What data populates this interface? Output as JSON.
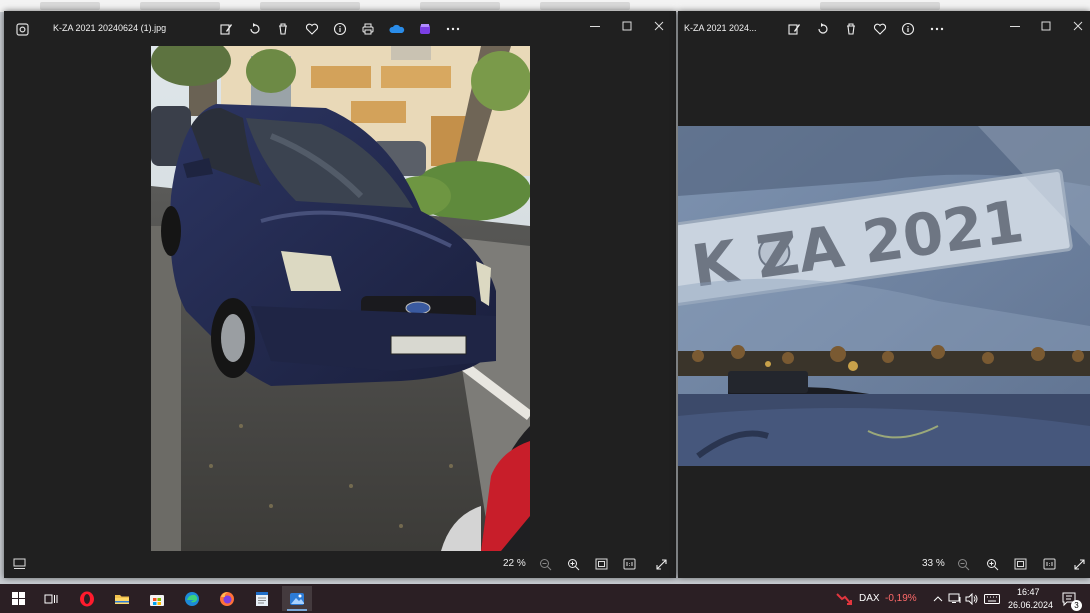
{
  "windows": [
    {
      "title": "K-ZA 2021 20240624   (1).jpg",
      "zoom": "22 %",
      "toolbar_icons": [
        "edit-icon",
        "rotate-icon",
        "delete-icon",
        "heart-icon",
        "info-icon",
        "print-icon",
        "onedrive-icon",
        "clipchamp-icon",
        "more-icon"
      ],
      "photo_subject": "blue-ford-car-parked-on-street"
    },
    {
      "title": "K-ZA 2021 2024...",
      "zoom": "33 %",
      "toolbar_icons": [
        "edit-icon",
        "rotate-icon",
        "delete-icon",
        "heart-icon",
        "info-icon",
        "more-icon"
      ],
      "photo_subject": "license-plate-behind-windshield"
    }
  ],
  "plate_text": "K ZA 2021",
  "taskbar": {
    "apps": [
      "start",
      "task-view",
      "opera",
      "file-explorer",
      "microsoft-store",
      "edge",
      "firefox",
      "notepad",
      "photos"
    ],
    "ticker_name": "DAX",
    "ticker_value": "-0,19%",
    "time": "16:47",
    "date": "26.06.2024",
    "notifications": "3"
  },
  "colors": {
    "window_bg": "#202020",
    "taskbar_bg": "#2b1f24",
    "ticker_negative": "#ff6a6a",
    "accent_active": "#7aa7d8"
  }
}
